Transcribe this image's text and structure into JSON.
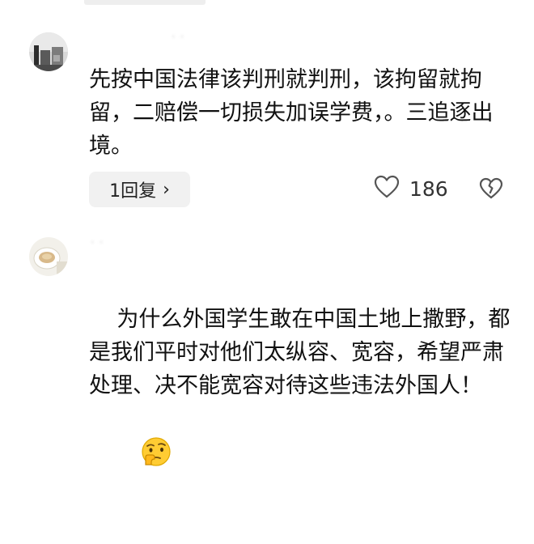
{
  "comments": [
    {
      "username": "· ·",
      "text": "先按中国法律该判刑就判刑，该拘留就拘留，二赔偿一切损失加误学费，。三追逐出境。",
      "reply_label": "1回复",
      "reply_chevron": "›",
      "like_count": "186",
      "like_icon": "heart-outline-icon",
      "dislike_icon": "broken-heart-icon"
    },
    {
      "username": "· ·",
      "text": "为什么外国学生敢在中国土地上撒野，都是我们平时对他们太纵容、宽容，希望严肃处理、决不能宽容对待这些违法外国人！",
      "emoji_icon": "thinking-face-emoji-icon"
    }
  ],
  "colors": {
    "text": "#111111",
    "muted": "#c4c4c4",
    "reply_bg": "#f1f1f1",
    "icon": "#555555"
  }
}
